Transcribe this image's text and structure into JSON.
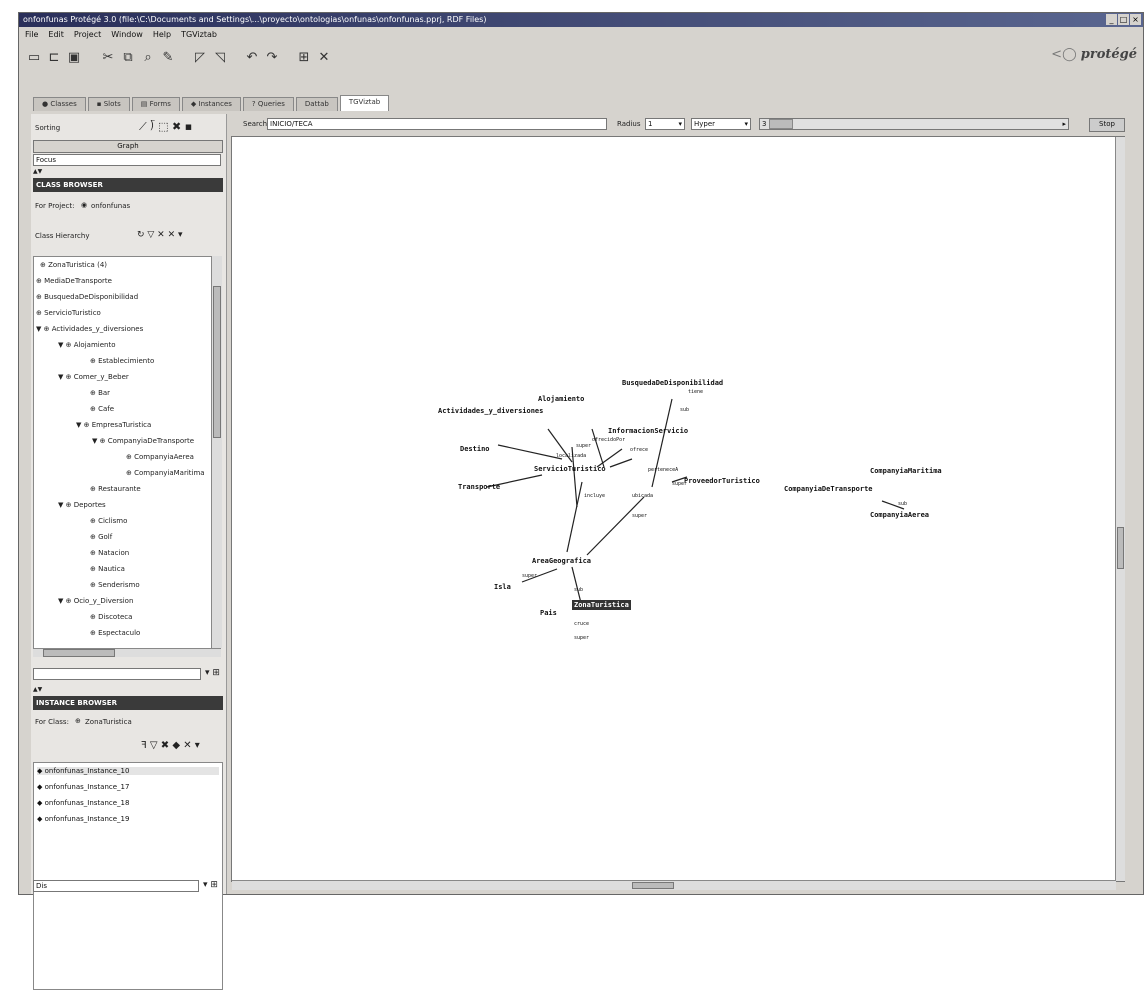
{
  "window": {
    "title": "onfonfunas Protégé 3.0   (file:\\C:\\Documents and Settings\\...\\proyecto\\ontologias\\onfunas\\onfonfunas.pprj, RDF Files)"
  },
  "menu": [
    "File",
    "Edit",
    "Project",
    "Window",
    "Help",
    "TGViztab"
  ],
  "logo": "protégé",
  "tabs": [
    {
      "label": "Classes",
      "active": false
    },
    {
      "label": "Slots",
      "active": false
    },
    {
      "label": "Forms",
      "active": false
    },
    {
      "label": "Instances",
      "active": false
    },
    {
      "label": "Queries",
      "active": false
    },
    {
      "label": "Dattab",
      "active": false
    },
    {
      "label": "TGViztab",
      "active": true
    }
  ],
  "left": {
    "search_label": "Sorting",
    "view_button": "Graph",
    "filter_value": "Focus",
    "class_browser_header": "CLASS BROWSER",
    "for_project_label": "For Project:",
    "project_name": "onfonfunas",
    "class_hierarchy_label": "Class Hierarchy",
    "tree": [
      {
        "label": "ZonaTuristica",
        "indent": 1
      },
      {
        "label": "MediaDeTransporte",
        "indent": 0
      },
      {
        "label": "BusquedaDeDisponibilidad",
        "indent": 0
      },
      {
        "label": "ServicioTuristico",
        "indent": 0
      },
      {
        "label": "Actividades_y_diversiones",
        "indent": 0,
        "expanded": true
      },
      {
        "label": "Alojamiento",
        "indent": 1,
        "expanded": true
      },
      {
        "label": "Establecimiento",
        "indent": 2
      },
      {
        "label": "Comer_y_Beber",
        "indent": 1,
        "expanded": true
      },
      {
        "label": "Bar",
        "indent": 2
      },
      {
        "label": "Cafe",
        "indent": 2
      },
      {
        "label": "EmpresaTuristica",
        "indent": 2,
        "expanded": true
      },
      {
        "label": "CompanyiaDeTransporte",
        "indent": 3,
        "expanded": true
      },
      {
        "label": "CompanyiaAerea",
        "indent": 4
      },
      {
        "label": "CompanyiaMaritima",
        "indent": 4
      },
      {
        "label": "Restaurante",
        "indent": 2
      },
      {
        "label": "Deportes",
        "indent": 1,
        "expanded": true
      },
      {
        "label": "Ciclismo",
        "indent": 2
      },
      {
        "label": "Golf",
        "indent": 2
      },
      {
        "label": "Natacion",
        "indent": 2
      },
      {
        "label": "Nautica",
        "indent": 2
      },
      {
        "label": "Senderismo",
        "indent": 2
      },
      {
        "label": "Ocio_y_Diversion",
        "indent": 1,
        "expanded": true
      },
      {
        "label": "Discoteca",
        "indent": 2
      },
      {
        "label": "Espectaculo",
        "indent": 2
      }
    ],
    "instance_browser_header": "INSTANCE BROWSER",
    "for_class_label": "For Class:",
    "class_name": "ZonaTuristica",
    "instances": [
      "onfonfunas_Instance_10",
      "onfonfunas_Instance_17",
      "onfonfunas_Instance_18",
      "onfonfunas_Instance_19"
    ],
    "bottom_filter": "Dis"
  },
  "graph_toolbar": {
    "search_label": "Search",
    "search_value": "INICIO/TECA",
    "radius_label": "Radius",
    "radius_value": "1",
    "hyper_label": "Hyper",
    "zoom_value": "3",
    "stop_button": "Stop"
  },
  "graph": {
    "nodes": [
      {
        "id": "disp",
        "label": "BusquedaDeDisponibilidad"
      },
      {
        "id": "aloj",
        "label": "Alojamiento"
      },
      {
        "id": "act",
        "label": "Actividades_y_diversiones"
      },
      {
        "id": "info",
        "label": "InformacionServicio"
      },
      {
        "id": "dest",
        "label": "Destino"
      },
      {
        "id": "serv",
        "label": "ServicioTuristico"
      },
      {
        "id": "trans",
        "label": "Transporte"
      },
      {
        "id": "prov",
        "label": "ProveedorTuristico"
      },
      {
        "id": "cdt",
        "label": "CompanyiaDeTransporte"
      },
      {
        "id": "cmar",
        "label": "CompanyiaMaritima"
      },
      {
        "id": "caer",
        "label": "CompanyiaAerea"
      },
      {
        "id": "geo",
        "label": "AreaGeografica"
      },
      {
        "id": "isla",
        "label": "Isla"
      },
      {
        "id": "zona",
        "label": "ZonaTuristica",
        "selected": true
      },
      {
        "id": "pais",
        "label": "Pais"
      }
    ],
    "edge_labels": [
      "tiene",
      "sub",
      "ofrece",
      "super",
      "ofrecidoPor",
      "localizada",
      "perteneceA",
      "incluye",
      "ubicada",
      "super",
      "super",
      "sub",
      "super",
      "sub",
      "cruce",
      "super"
    ]
  }
}
